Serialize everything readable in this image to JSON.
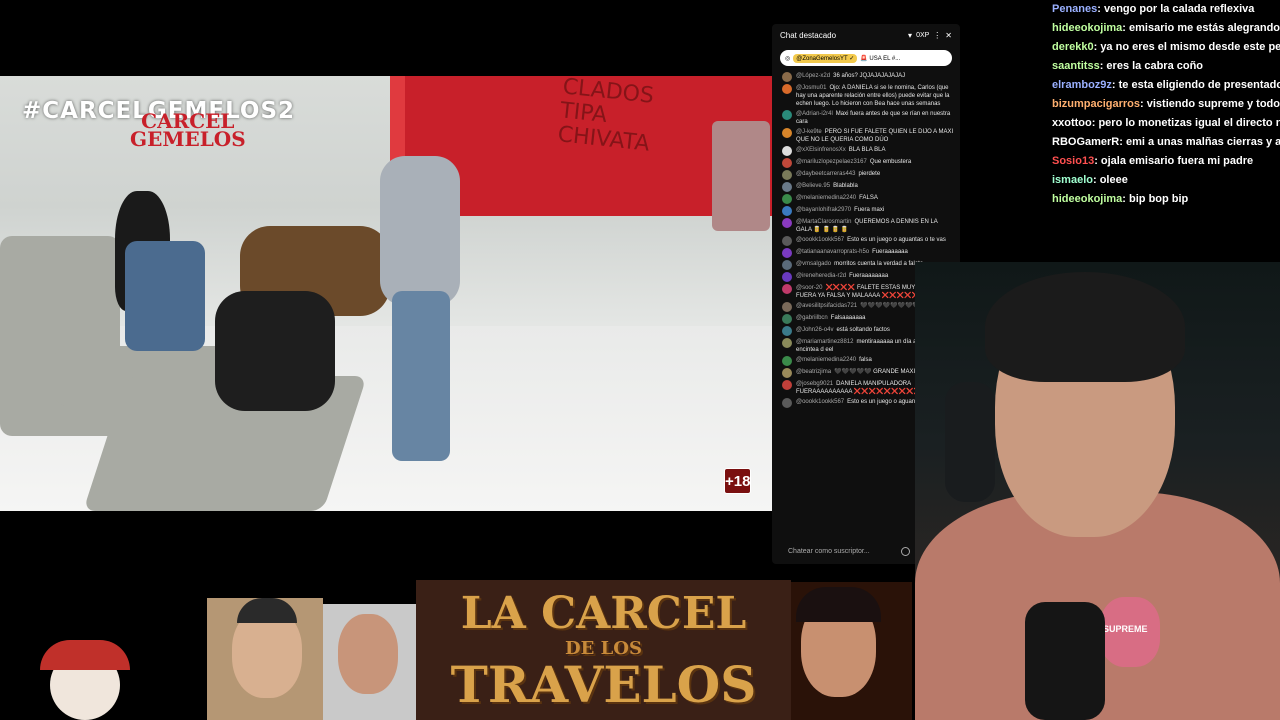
{
  "video": {
    "hashtag": "#CARCELGEMELOS2",
    "wall_logo_line1": "CARCEL",
    "wall_logo_line2": "GEMELOS",
    "graffiti": "CLADOS\nTIPA\nCHIVATA",
    "rating": "+18"
  },
  "chat_panel": {
    "title": "Chat destacado",
    "points": "0XP",
    "pinned_user": "@ZonaGemelosYT ✓",
    "pinned_text": "🚨 USA EL #...",
    "input_placeholder": "Chatear como suscriptor...",
    "messages": [
      {
        "user": "@López-x2d",
        "text": "36 años? JQJAJAJAJAJAJ",
        "color": "#8a6b4a"
      },
      {
        "user": "@Josmu01",
        "text": "Ojo: A DANIELA si se le nomina, Carlos (que hay una aparente relación entre ellos) puede evitar que la echen luego. Lo hicieron con Bea hace unas semanas",
        "color": "#d86a2a"
      },
      {
        "user": "@Adrian-i2r4l",
        "text": "Maxi fuera antes de que se rían en nuestra cara",
        "color": "#2a8a7a"
      },
      {
        "user": "@J-ke9te",
        "text": "PERO SI FUE FALETE QUIEN LE DIJO A MAXI QUE NO LE QUERIA COMO DÚO",
        "color": "#d8852a"
      },
      {
        "user": "@xXElsinfrenosXx",
        "text": "BLA BLA BLA",
        "color": "#dddddd"
      },
      {
        "user": "@mariluzlopezpelaez3167",
        "text": "Que embustera",
        "color": "#c0483a"
      },
      {
        "user": "@daybeetcarreras443",
        "text": "pierdete",
        "color": "#7a7a5a"
      },
      {
        "user": "@Believe.95",
        "text": "Blablabla",
        "color": "#6a7a8a"
      },
      {
        "user": "@melaniemedina2240",
        "text": "FALSA",
        "color": "#3a8a4a"
      },
      {
        "user": "@bayanlohifrak2970",
        "text": "Fuera maxi",
        "color": "#3a7ac0"
      },
      {
        "user": "@MartaClarosmartin",
        "text": "QUEREMOS A DENNIS EN LA GALA 🥫 🥫 🥫 🥫",
        "color": "#8a3ac0"
      },
      {
        "user": "@oookk1ookk567",
        "text": "Esto es un juego o aguantas o te vas",
        "color": "#5a5a5a"
      },
      {
        "user": "@tatianaanavarroprats-h5o",
        "text": "Fueraaaaaaa",
        "color": "#7a3ac0"
      },
      {
        "user": "@vmsalgado",
        "text": "morritos cuenta la verdad a falete",
        "color": "#5a6a7a"
      },
      {
        "user": "@ireneheredia-r2d",
        "text": "Fueraaaaaaaa",
        "color": "#6a3ac0"
      },
      {
        "user": "@soor-20",
        "text": "❌❌❌❌ FALETE ESTAS MUY SUBIDITA FUERA YA FALSA Y MALAAAA ❌❌❌❌❌",
        "color": "#c03a6a"
      },
      {
        "user": "@avesilitpsifacidas721",
        "text": "🖤🖤🖤🖤🖤🖤🖤🖤🖤",
        "color": "#7a6a5a"
      },
      {
        "user": "@gabriilbcn",
        "text": "Falsaaaaaaa",
        "color": "#3a7a5a"
      },
      {
        "user": "@John26-o4v",
        "text": "está soltando factos",
        "color": "#3a7a8a"
      },
      {
        "user": "@mariamartinez8812",
        "text": "mentiraaaaaa un día antes i a encintea d eel",
        "color": "#8a8a5a"
      },
      {
        "user": "@melaniemedina2240",
        "text": "falsa",
        "color": "#3a8a4a"
      },
      {
        "user": "@beatrizjima",
        "text": "🖤🖤🖤🖤🖤 GRANDE MAXI",
        "color": "#9a8a5a"
      },
      {
        "user": "@josebg9021",
        "text": "DANIELA MANIPULADORA FUERAAAAAAAAAA ❌❌❌❌❌❌❌❌❌❌❌",
        "color": "#c0403a"
      },
      {
        "user": "@oookk1ookk567",
        "text": "Esto es un juego o aguantas o te vas",
        "color": "#5a5a5a"
      }
    ]
  },
  "stream_chat": [
    {
      "name": "Penanes",
      "text": ": vengo por la calada reflexiva",
      "color": "#9ab0ff"
    },
    {
      "name": "hideeokojima",
      "text": ": emisario me estás alegrando l",
      "color": "#c0ffa0"
    },
    {
      "name": "derekk0",
      "text": ": ya no eres el mismo desde este pelota",
      "color": "#c0ffa0"
    },
    {
      "name": "saantitss",
      "text": ": eres la cabra coño",
      "color": "#c0ffa0"
    },
    {
      "name": "elramboz9z",
      "text": ": te esta eligiendo de presentador ne",
      "color": "#9ab0ff"
    },
    {
      "name": "bizumpacigarros",
      "text": ": vistiendo supreme y todo ya k",
      "color": "#ffb070"
    },
    {
      "name": "xxottoo",
      "text": ": pero lo monetizas igual el directo no",
      "color": "#ffffff"
    },
    {
      "name": "RBOGamerR",
      "text": ": emi a unas malñas cierras y abr",
      "color": "#ffffff"
    },
    {
      "name": "Sosio13",
      "text": ": ojala emisario fuera mi padre",
      "color": "#ff5050"
    },
    {
      "name": "ismaelo",
      "text": ": oleee",
      "color": "#a0ffd0"
    },
    {
      "name": "hideeokojima",
      "text": ": bip bop bip",
      "color": "#c0ffa0"
    }
  ],
  "webcam": {
    "shirt_text": "SUPREME"
  },
  "bottom_banner": {
    "line1": "LA CARCEL",
    "line2": "DE LOS",
    "line3": "TRAVELOS"
  }
}
